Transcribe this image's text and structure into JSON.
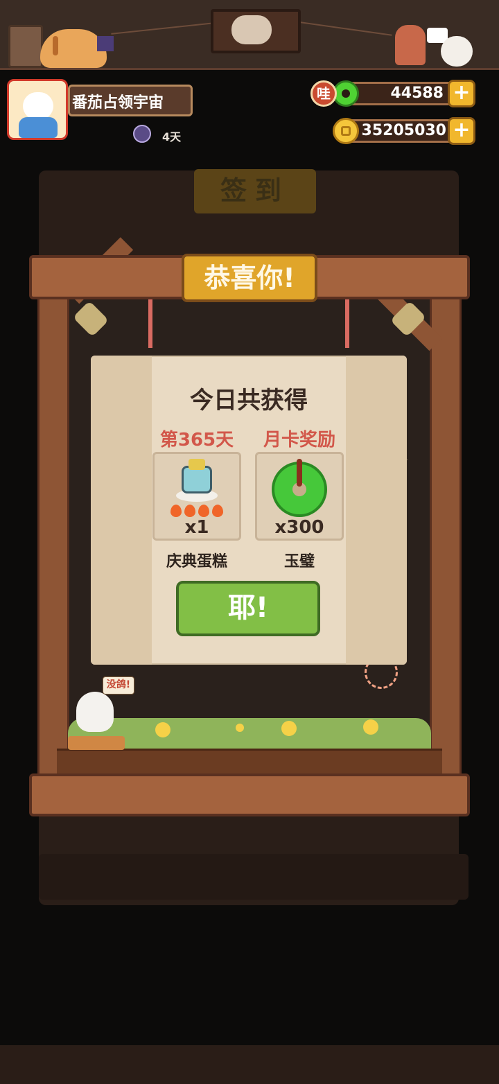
{
  "player": {
    "name": "番茄占领宇宙",
    "streak": "4天"
  },
  "currency": {
    "jade_badge": "哇",
    "jade_amount": "44588",
    "coins_amount": "35205030",
    "add_symbol": "+"
  },
  "background": {
    "signin_title": "签到"
  },
  "popup": {
    "banner": "恭喜你!",
    "title": "今日共获得",
    "rewards": [
      {
        "label": "第365天",
        "qty": "x1",
        "name": "庆典蛋糕",
        "icon": "celebration-cake-icon"
      },
      {
        "label": "月卡奖励",
        "qty": "x300",
        "name": "玉璧",
        "icon": "jade-disc-icon"
      }
    ],
    "confirm_button": "耶!"
  },
  "mascot": {
    "speech": "没鸽!"
  },
  "colors": {
    "accent_green": "#82bf46",
    "reward_label": "#d2574a",
    "wood": "#a4633e",
    "card": "#e9dac3"
  }
}
